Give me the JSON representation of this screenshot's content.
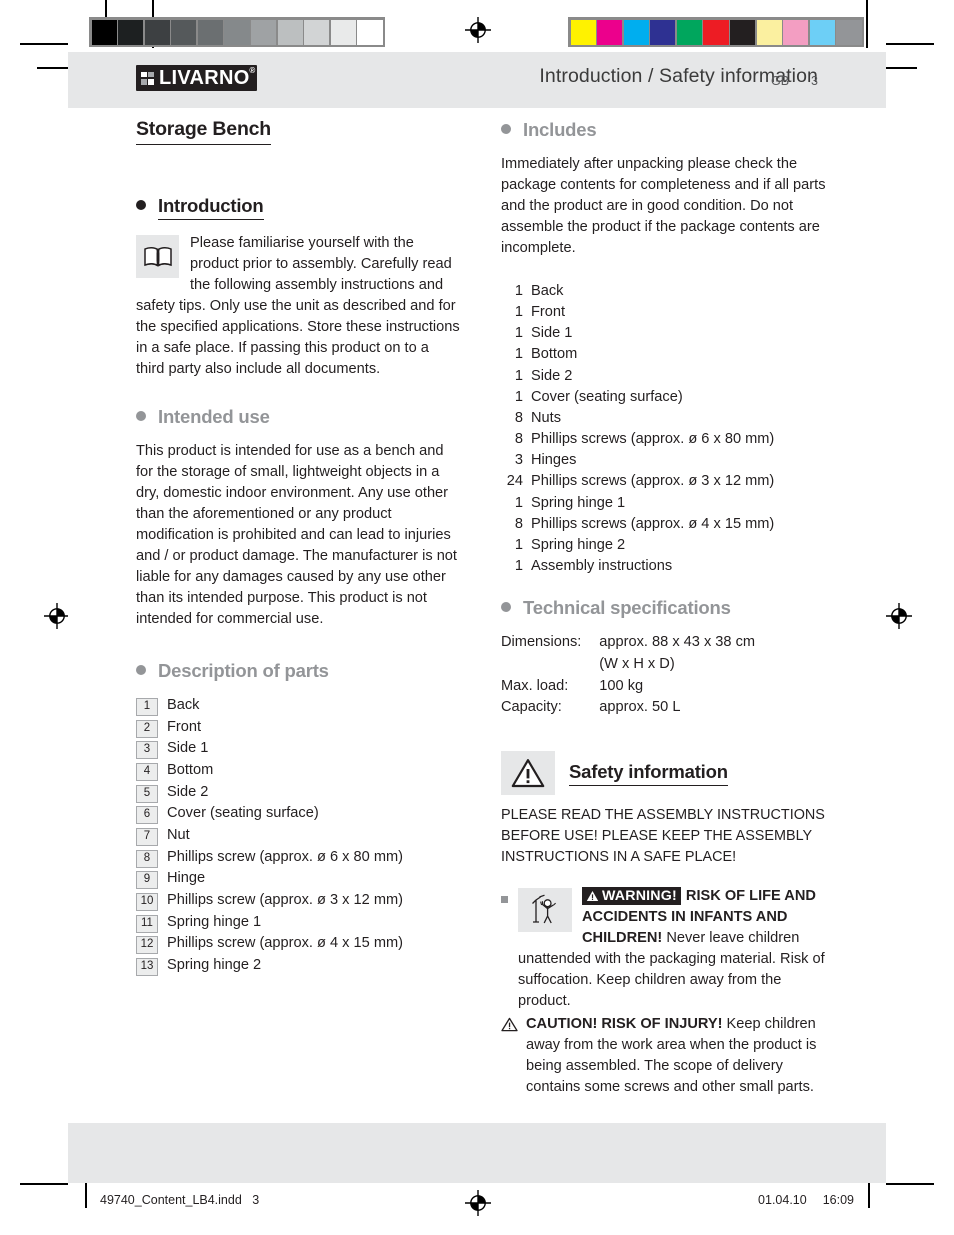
{
  "header": {
    "title": "Introduction / Safety information"
  },
  "product": {
    "title": "Storage Bench"
  },
  "sections": {
    "introduction": {
      "heading": "Introduction",
      "icon": "book-info-icon",
      "text": "Please familiarise yourself with the product prior to assembly. Carefully read the following assembly instructions and safety tips. Only use the unit as described and for the specified applications. Store these instructions in a safe place. If passing this product on to a third party also include all documents."
    },
    "intended_use": {
      "heading": "Intended use",
      "text": "This product is intended for use as a bench and for the storage of small, lightweight objects in a dry, domestic indoor environment. Any use other than the aforementioned or any product modification is prohibited and can lead to injuries and / or product damage. The manufacturer is not liable for any damages caused by any use other than its intended purpose. This product is not intended for commercial use."
    },
    "description_of_parts": {
      "heading": "Description of parts",
      "items": [
        {
          "num": "1",
          "label": "Back"
        },
        {
          "num": "2",
          "label": "Front"
        },
        {
          "num": "3",
          "label": "Side 1"
        },
        {
          "num": "4",
          "label": "Bottom"
        },
        {
          "num": "5",
          "label": "Side 2"
        },
        {
          "num": "6",
          "label": "Cover (seating surface)"
        },
        {
          "num": "7",
          "label": "Nut"
        },
        {
          "num": "8",
          "label": "Phillips screw (approx. ø 6 x 80 mm)"
        },
        {
          "num": "9",
          "label": "Hinge"
        },
        {
          "num": "10",
          "label": "Phillips screw (approx. ø 3 x 12 mm)"
        },
        {
          "num": "11",
          "label": "Spring hinge 1"
        },
        {
          "num": "12",
          "label": "Phillips screw (approx. ø 4 x 15 mm)"
        },
        {
          "num": "13",
          "label": "Spring hinge 2"
        }
      ]
    },
    "includes": {
      "heading": "Includes",
      "text": "Immediately after unpacking please check the package contents for completeness and if all parts and the product are in good condition. Do not assemble the product if the package contents are incomplete.",
      "items": [
        {
          "qty": "1",
          "label": "Back"
        },
        {
          "qty": "1",
          "label": "Front"
        },
        {
          "qty": "1",
          "label": "Side 1"
        },
        {
          "qty": "1",
          "label": "Bottom"
        },
        {
          "qty": "1",
          "label": "Side 2"
        },
        {
          "qty": "1",
          "label": "Cover (seating surface)"
        },
        {
          "qty": "8",
          "label": "Nuts"
        },
        {
          "qty": "8",
          "label": "Phillips screws (approx. ø 6 x 80 mm)"
        },
        {
          "qty": "3",
          "label": "Hinges"
        },
        {
          "qty": "24",
          "label": "Phillips screws (approx. ø 3 x 12 mm)"
        },
        {
          "qty": "1",
          "label": "Spring hinge 1"
        },
        {
          "qty": "8",
          "label": "Phillips screws (approx. ø 4 x 15 mm)"
        },
        {
          "qty": "1",
          "label": "Spring hinge 2"
        },
        {
          "qty": "1",
          "label": "Assembly instructions"
        }
      ]
    },
    "technical_specifications": {
      "heading": "Technical specifications",
      "rows": [
        {
          "key": "Dimensions:",
          "value": "approx. 88 x 43 x 38 cm"
        },
        {
          "key": "",
          "value": "(W x H x D)"
        },
        {
          "key": "Max. load:",
          "value": "100 kg"
        },
        {
          "key": "Capacity:",
          "value": "approx. 50 L"
        }
      ]
    },
    "safety_information": {
      "heading": "Safety information",
      "icon": "warning-triangle-icon",
      "intro": "PLEASE READ THE ASSEMBLY INSTRUCTIONS BEFORE USE! PLEASE KEEP THE ASSEMBLY INSTRUCTIONS IN A SAFE PLACE!",
      "warning": {
        "icon": "child-packaging-icon",
        "label": "WARNING!",
        "bold": "RISK OF LIFE AND ACCIDENTS IN INFANTS AND CHILDREN!",
        "text": " Never leave children unattended with the packaging material. Risk of suffocation. Keep children away from the product."
      },
      "caution": {
        "bold": "CAUTION! RISK OF INJURY!",
        "text": " Keep children away from the work area when the product is being assembled. The scope of delivery contains some screws and other small parts."
      }
    }
  },
  "footer": {
    "logo_text": "LIVARNO",
    "logo_mark": "®",
    "locale": "GB",
    "page_number": "3"
  },
  "print_line": {
    "file": "49740_Content_LB4.indd",
    "page": "3",
    "date": "01.04.10",
    "time": "16:09"
  },
  "color_bars": {
    "gray_swatches": [
      "#000000",
      "#1d2021",
      "#3d4042",
      "#55595b",
      "#6b6f71",
      "#85898b",
      "#9fa2a4",
      "#bcbfc0",
      "#d2d4d5",
      "#e9eaea",
      "#ffffff"
    ],
    "color_swatches": [
      "#fff200",
      "#ec008c",
      "#00aeef",
      "#2e3192",
      "#00a65d",
      "#ed1c24",
      "#231f20",
      "#fbf0a0",
      "#f39ec2",
      "#6dcff6",
      "#939598"
    ]
  },
  "colors": {
    "band": "#e6e7e8",
    "heading_gray": "#939598",
    "ink": "#231f20"
  }
}
